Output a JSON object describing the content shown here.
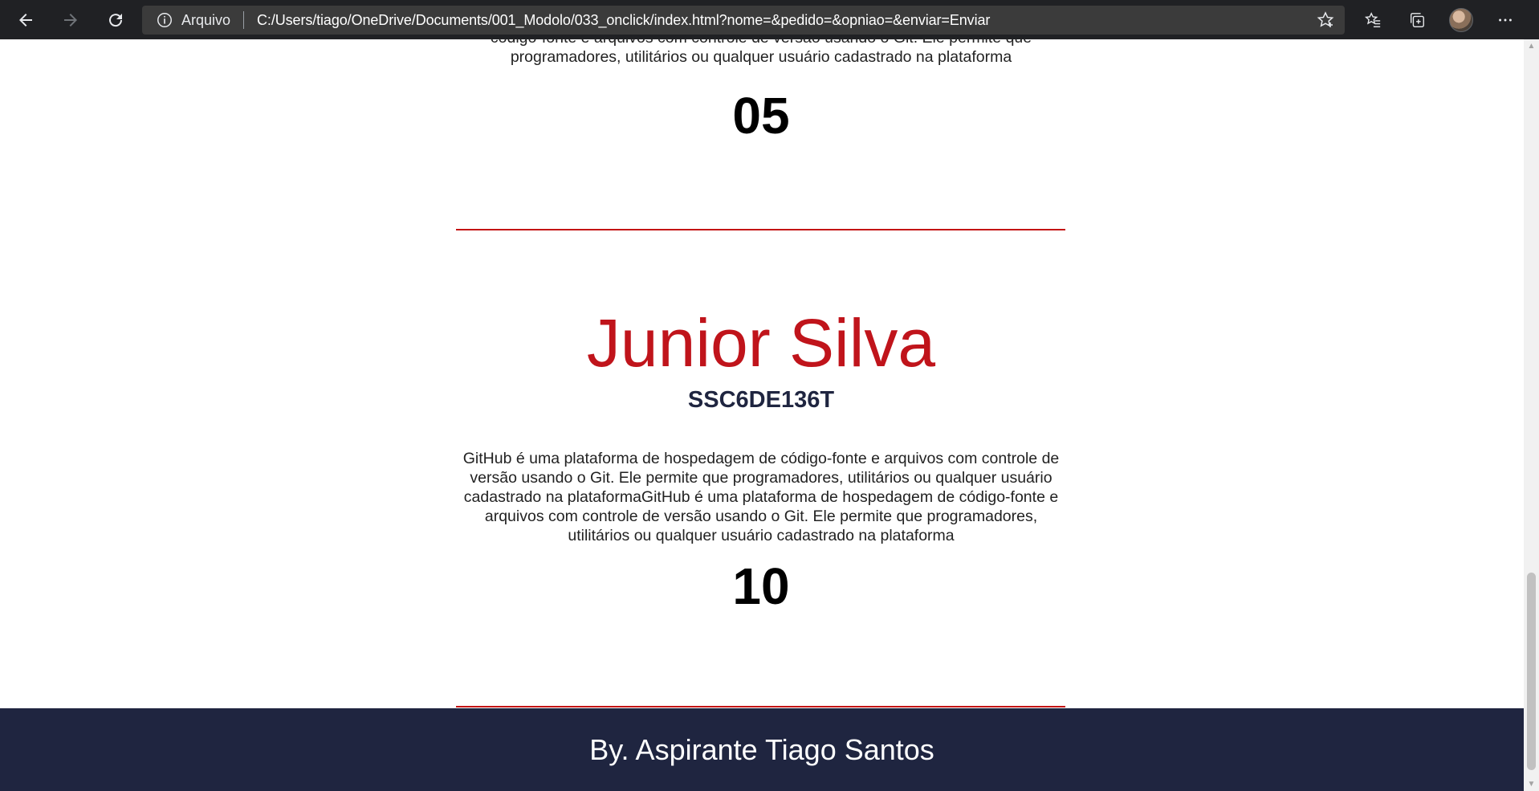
{
  "browser": {
    "site_label": "Arquivo",
    "url": "C:/Users/tiago/OneDrive/Documents/001_Modolo/033_onclick/index.html?nome=&pedido=&opniao=&enviar=Enviar",
    "icons": [
      "back-icon",
      "forward-icon",
      "refresh-icon",
      "info-icon",
      "add-favorite-icon",
      "favorites-icon",
      "collections-icon",
      "profile-avatar",
      "more-icon"
    ]
  },
  "previous_card": {
    "description_tail": "código-fonte e arquivos com controle de versão usando o Git. Ele permite que programadores, utilitários ou qualquer usuário cadastrado na plataforma",
    "score": "05"
  },
  "card": {
    "name": "Junior Silva",
    "code": "SSC6DE136T",
    "description": "GitHub é uma plataforma de hospedagem de código-fonte e arquivos com controle de versão usando o Git. Ele permite que programadores, utilitários ou qualquer usuário cadastrado na plataformaGitHub é uma plataforma de hospedagem de código-fonte e arquivos com controle de versão usando o Git. Ele permite que programadores, utilitários ou qualquer usuário cadastrado na plataforma",
    "score": "10"
  },
  "footer": {
    "text": "By. Aspirante Tiago Santos"
  },
  "colors": {
    "chrome_bg": "#202124",
    "accent_red": "#c0141b",
    "footer_bg": "#1f2540"
  }
}
